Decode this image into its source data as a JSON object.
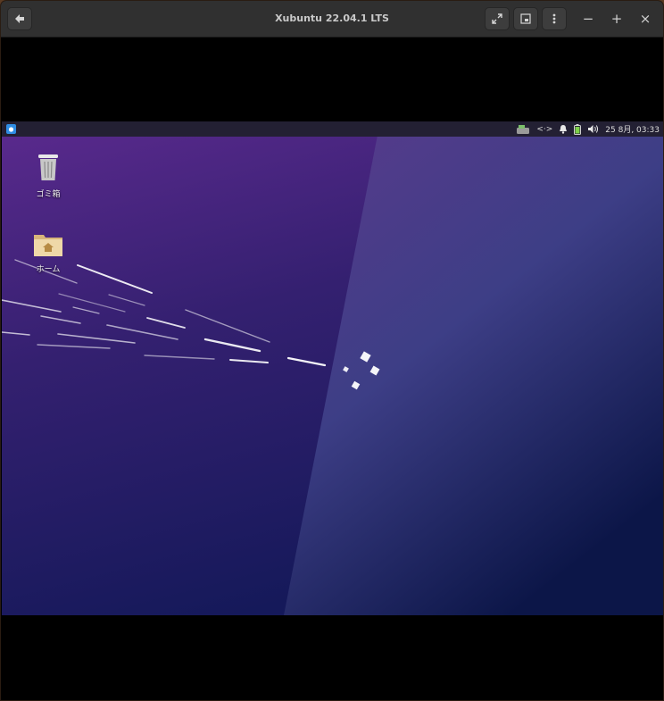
{
  "window": {
    "title": "Xubuntu 22.04.1 LTS",
    "controls": {
      "minimize": "−",
      "maximize": "+",
      "close": "×"
    }
  },
  "panel": {
    "network": "<·>",
    "date": "25 8月, 03:33"
  },
  "desktop": {
    "icons": [
      {
        "label": "ゴミ箱",
        "icon": "trash-icon"
      },
      {
        "label": "ホーム",
        "icon": "home-folder-icon"
      }
    ]
  },
  "colors": {
    "titlebar": "#303030",
    "panel": "#232033",
    "wallpaper_top": "#5b2a8e",
    "wallpaper_bottom": "#15195a"
  }
}
